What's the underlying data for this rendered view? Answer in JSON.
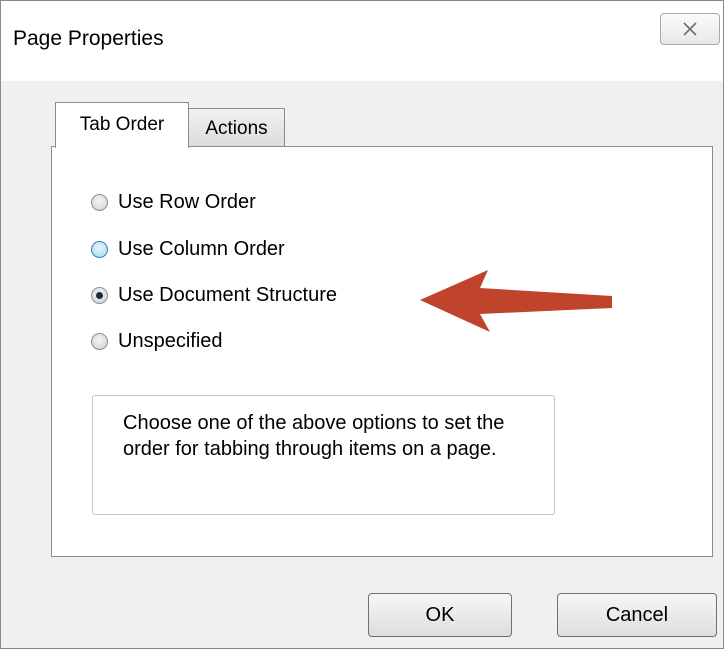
{
  "window": {
    "title": "Page Properties"
  },
  "tabs": [
    {
      "label": "Tab Order",
      "active": true
    },
    {
      "label": "Actions",
      "active": false
    }
  ],
  "options": [
    {
      "label": "Use Row Order",
      "checked": false
    },
    {
      "label": "Use Column Order",
      "checked": false
    },
    {
      "label": "Use Document Structure",
      "checked": true
    },
    {
      "label": "Unspecified",
      "checked": false
    }
  ],
  "info_text": "Choose one of the above options to set the order for tabbing through items on a page.",
  "buttons": {
    "ok_label": "OK",
    "cancel_label": "Cancel"
  },
  "colors": {
    "annotation_arrow": "#c0432b",
    "dialog_background": "#f0f0f0",
    "hover_radio": "#b9e1f6"
  },
  "icons": {
    "close": "close-icon",
    "arrow": "arrow-left-icon"
  }
}
